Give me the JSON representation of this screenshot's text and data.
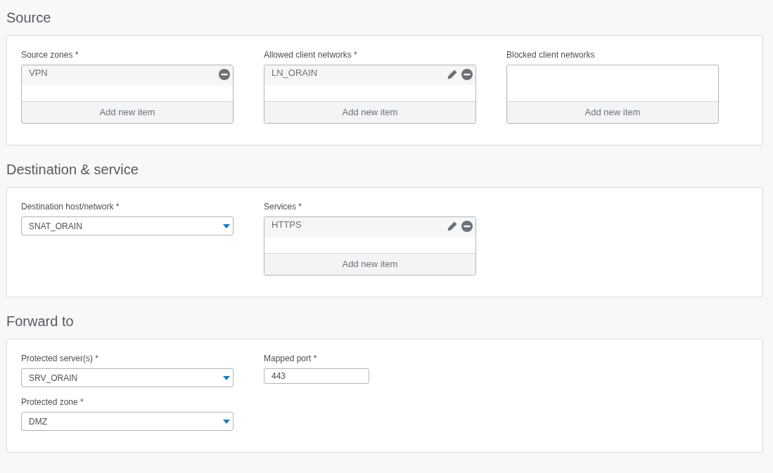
{
  "sections": [
    {
      "title": "Source",
      "columns": [
        [
          {
            "kind": "list",
            "label": "Source zones *",
            "items": [
              {
                "text": "VPN",
                "editable": false
              }
            ],
            "add_label": "Add new item"
          }
        ],
        [
          {
            "kind": "list",
            "label": "Allowed client networks *",
            "items": [
              {
                "text": "LN_ORAIN",
                "editable": true
              }
            ],
            "add_label": "Add new item"
          }
        ],
        [
          {
            "kind": "list",
            "label": "Blocked client networks",
            "add_label": "Add new item"
          }
        ]
      ]
    },
    {
      "title": "Destination & service",
      "columns": [
        [
          {
            "kind": "select",
            "label": "Destination host/network *",
            "value": "SNAT_ORAIN"
          }
        ],
        [
          {
            "kind": "list",
            "label": "Services *",
            "items": [
              {
                "text": "HTTPS",
                "editable": true
              }
            ],
            "add_label": "Add new item"
          }
        ]
      ]
    },
    {
      "title": "Forward to",
      "columns": [
        [
          {
            "kind": "select",
            "label": "Protected server(s) *",
            "value": "SRV_ORAIN"
          },
          {
            "kind": "select",
            "label": "Protected zone *",
            "value": "DMZ"
          }
        ],
        [
          {
            "kind": "text",
            "label": "Mapped port *",
            "value": "443"
          }
        ]
      ]
    }
  ]
}
